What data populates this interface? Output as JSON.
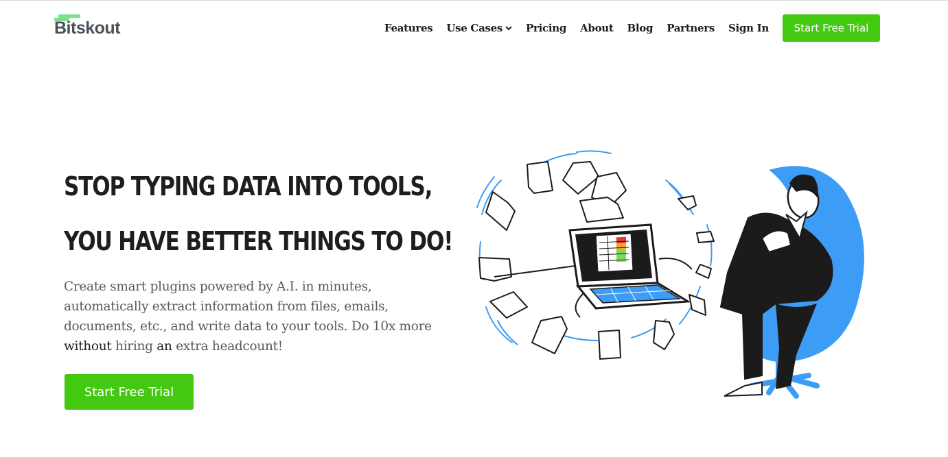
{
  "brand": {
    "name": "Bitskout",
    "accent_color": "#43c90f",
    "logo_mark_color": "#7ee08a",
    "text_color": "#1e1e1e"
  },
  "nav": {
    "items": [
      {
        "label": "Features",
        "has_dropdown": false
      },
      {
        "label": "Use Cases",
        "has_dropdown": true,
        "icon": "chevron-down-icon"
      },
      {
        "label": "Pricing",
        "has_dropdown": false
      },
      {
        "label": "About",
        "has_dropdown": false
      },
      {
        "label": "Blog",
        "has_dropdown": false
      },
      {
        "label": "Partners",
        "has_dropdown": false
      },
      {
        "label": "Sign In",
        "has_dropdown": false
      }
    ],
    "cta_label": "Start Free Trial"
  },
  "hero": {
    "title_line1": "STOP TYPING DATA INTO TOOLS,",
    "title_line2": "YOU HAVE BETTER THINGS TO DO!",
    "subtitle_part1": "Create smart plugins powered by A.I. in minutes, automatically extract information from files, emails, documents, etc., and write data to your tools. Do 10x more ",
    "subtitle_without": "without",
    "subtitle_part2": " hiring ",
    "subtitle_an": "an",
    "subtitle_part3": " extra headcount!",
    "cta_label": "Start Free Trial",
    "illustration": "man-in-blue-chair-with-laptop-and-flying-documents",
    "illustration_colors": {
      "chair": "#3d9cf5",
      "suit": "#1b1b1b",
      "screen_cells": [
        "#e53935",
        "#f5a623",
        "#7ed957"
      ]
    }
  }
}
